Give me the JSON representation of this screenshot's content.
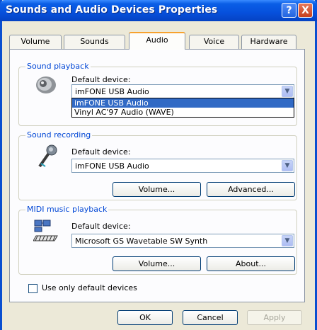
{
  "window": {
    "title": "Sounds and Audio Devices Properties",
    "help_glyph": "?",
    "close_glyph": "X"
  },
  "tabs": [
    {
      "label": "Volume"
    },
    {
      "label": "Sounds"
    },
    {
      "label": "Audio"
    },
    {
      "label": "Voice"
    },
    {
      "label": "Hardware"
    }
  ],
  "active_tab": "Audio",
  "playback": {
    "group_label": "Sound playback",
    "default_label": "Default device:",
    "selected": "imFONE USB Audio",
    "options": [
      "imFONE USB Audio",
      "Vinyl AC'97 Audio (WAVE)"
    ],
    "dropdown_open": true
  },
  "recording": {
    "group_label": "Sound recording",
    "default_label": "Default device:",
    "selected": "imFONE USB Audio",
    "volume_button": "Volume...",
    "advanced_button": "Advanced..."
  },
  "midi": {
    "group_label": "MIDI music playback",
    "default_label": "Default device:",
    "selected": "Microsoft GS Wavetable SW Synth",
    "volume_button": "Volume...",
    "about_button": "About..."
  },
  "only_default": {
    "label": "Use only default devices",
    "checked": false
  },
  "footer": {
    "ok": "OK",
    "cancel": "Cancel",
    "apply": "Apply"
  },
  "colors": {
    "titlebar": "#0650dc",
    "group_label": "#0046d5",
    "active_tab_accent": "#f7a22e",
    "selection": "#316ac5"
  }
}
